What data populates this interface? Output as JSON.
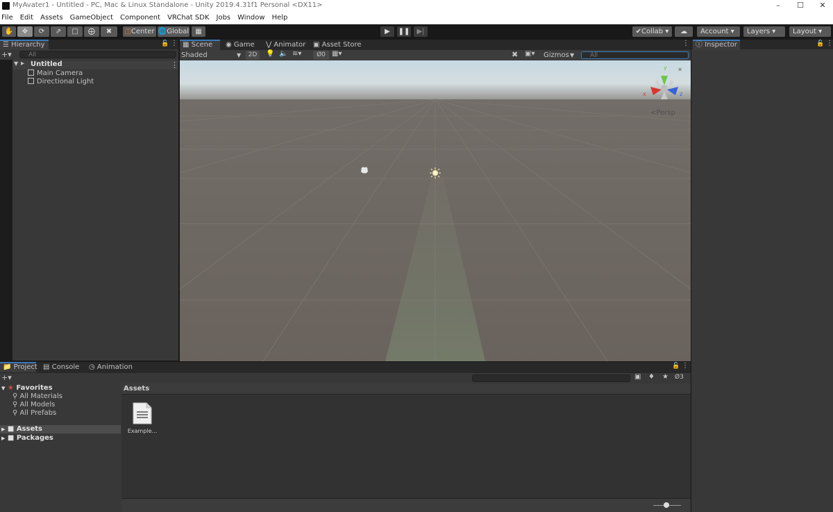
{
  "window": {
    "title": "MyAvater1 - Untitled - PC, Mac & Linux Standalone - Unity 2019.4.31f1 Personal <DX11>"
  },
  "menu": [
    "File",
    "Edit",
    "Assets",
    "GameObject",
    "Component",
    "VRChat SDK",
    "Jobs",
    "Window",
    "Help"
  ],
  "toolbar": {
    "center_label": "Center",
    "global_label": "Global",
    "collab_label": "Collab",
    "account_label": "Account",
    "layers_label": "Layers",
    "layout_label": "Layout"
  },
  "hierarchy": {
    "tab": "Hierarchy",
    "search_placeholder": "All",
    "scene_name": "Untitled",
    "items": [
      "Main Camera",
      "Directional Light"
    ]
  },
  "scene_tabs": [
    "Scene",
    "Game",
    "Animator",
    "Asset Store"
  ],
  "scene_toolbar": {
    "shading": "Shaded",
    "mode_2d": "2D",
    "hidden_count": "0",
    "gizmos": "Gizmos",
    "search_placeholder": "All",
    "persp": "Persp",
    "axis_y": "y",
    "axis_x": "x",
    "axis_z": "z"
  },
  "inspector": {
    "tab": "Inspector"
  },
  "bottom_tabs": [
    "Project",
    "Console",
    "Animation"
  ],
  "project": {
    "favorites_label": "Favorites",
    "favorites": [
      "All Materials",
      "All Models",
      "All Prefabs"
    ],
    "folders": [
      "Assets",
      "Packages"
    ],
    "breadcrumb": "Assets",
    "hidden_count": "3",
    "files": [
      {
        "name": "Example...",
        "icon": "document-icon"
      }
    ]
  },
  "colors": {
    "accent": "#3a79bb",
    "sky": "#c7d6df",
    "ground": "#6a635d"
  }
}
